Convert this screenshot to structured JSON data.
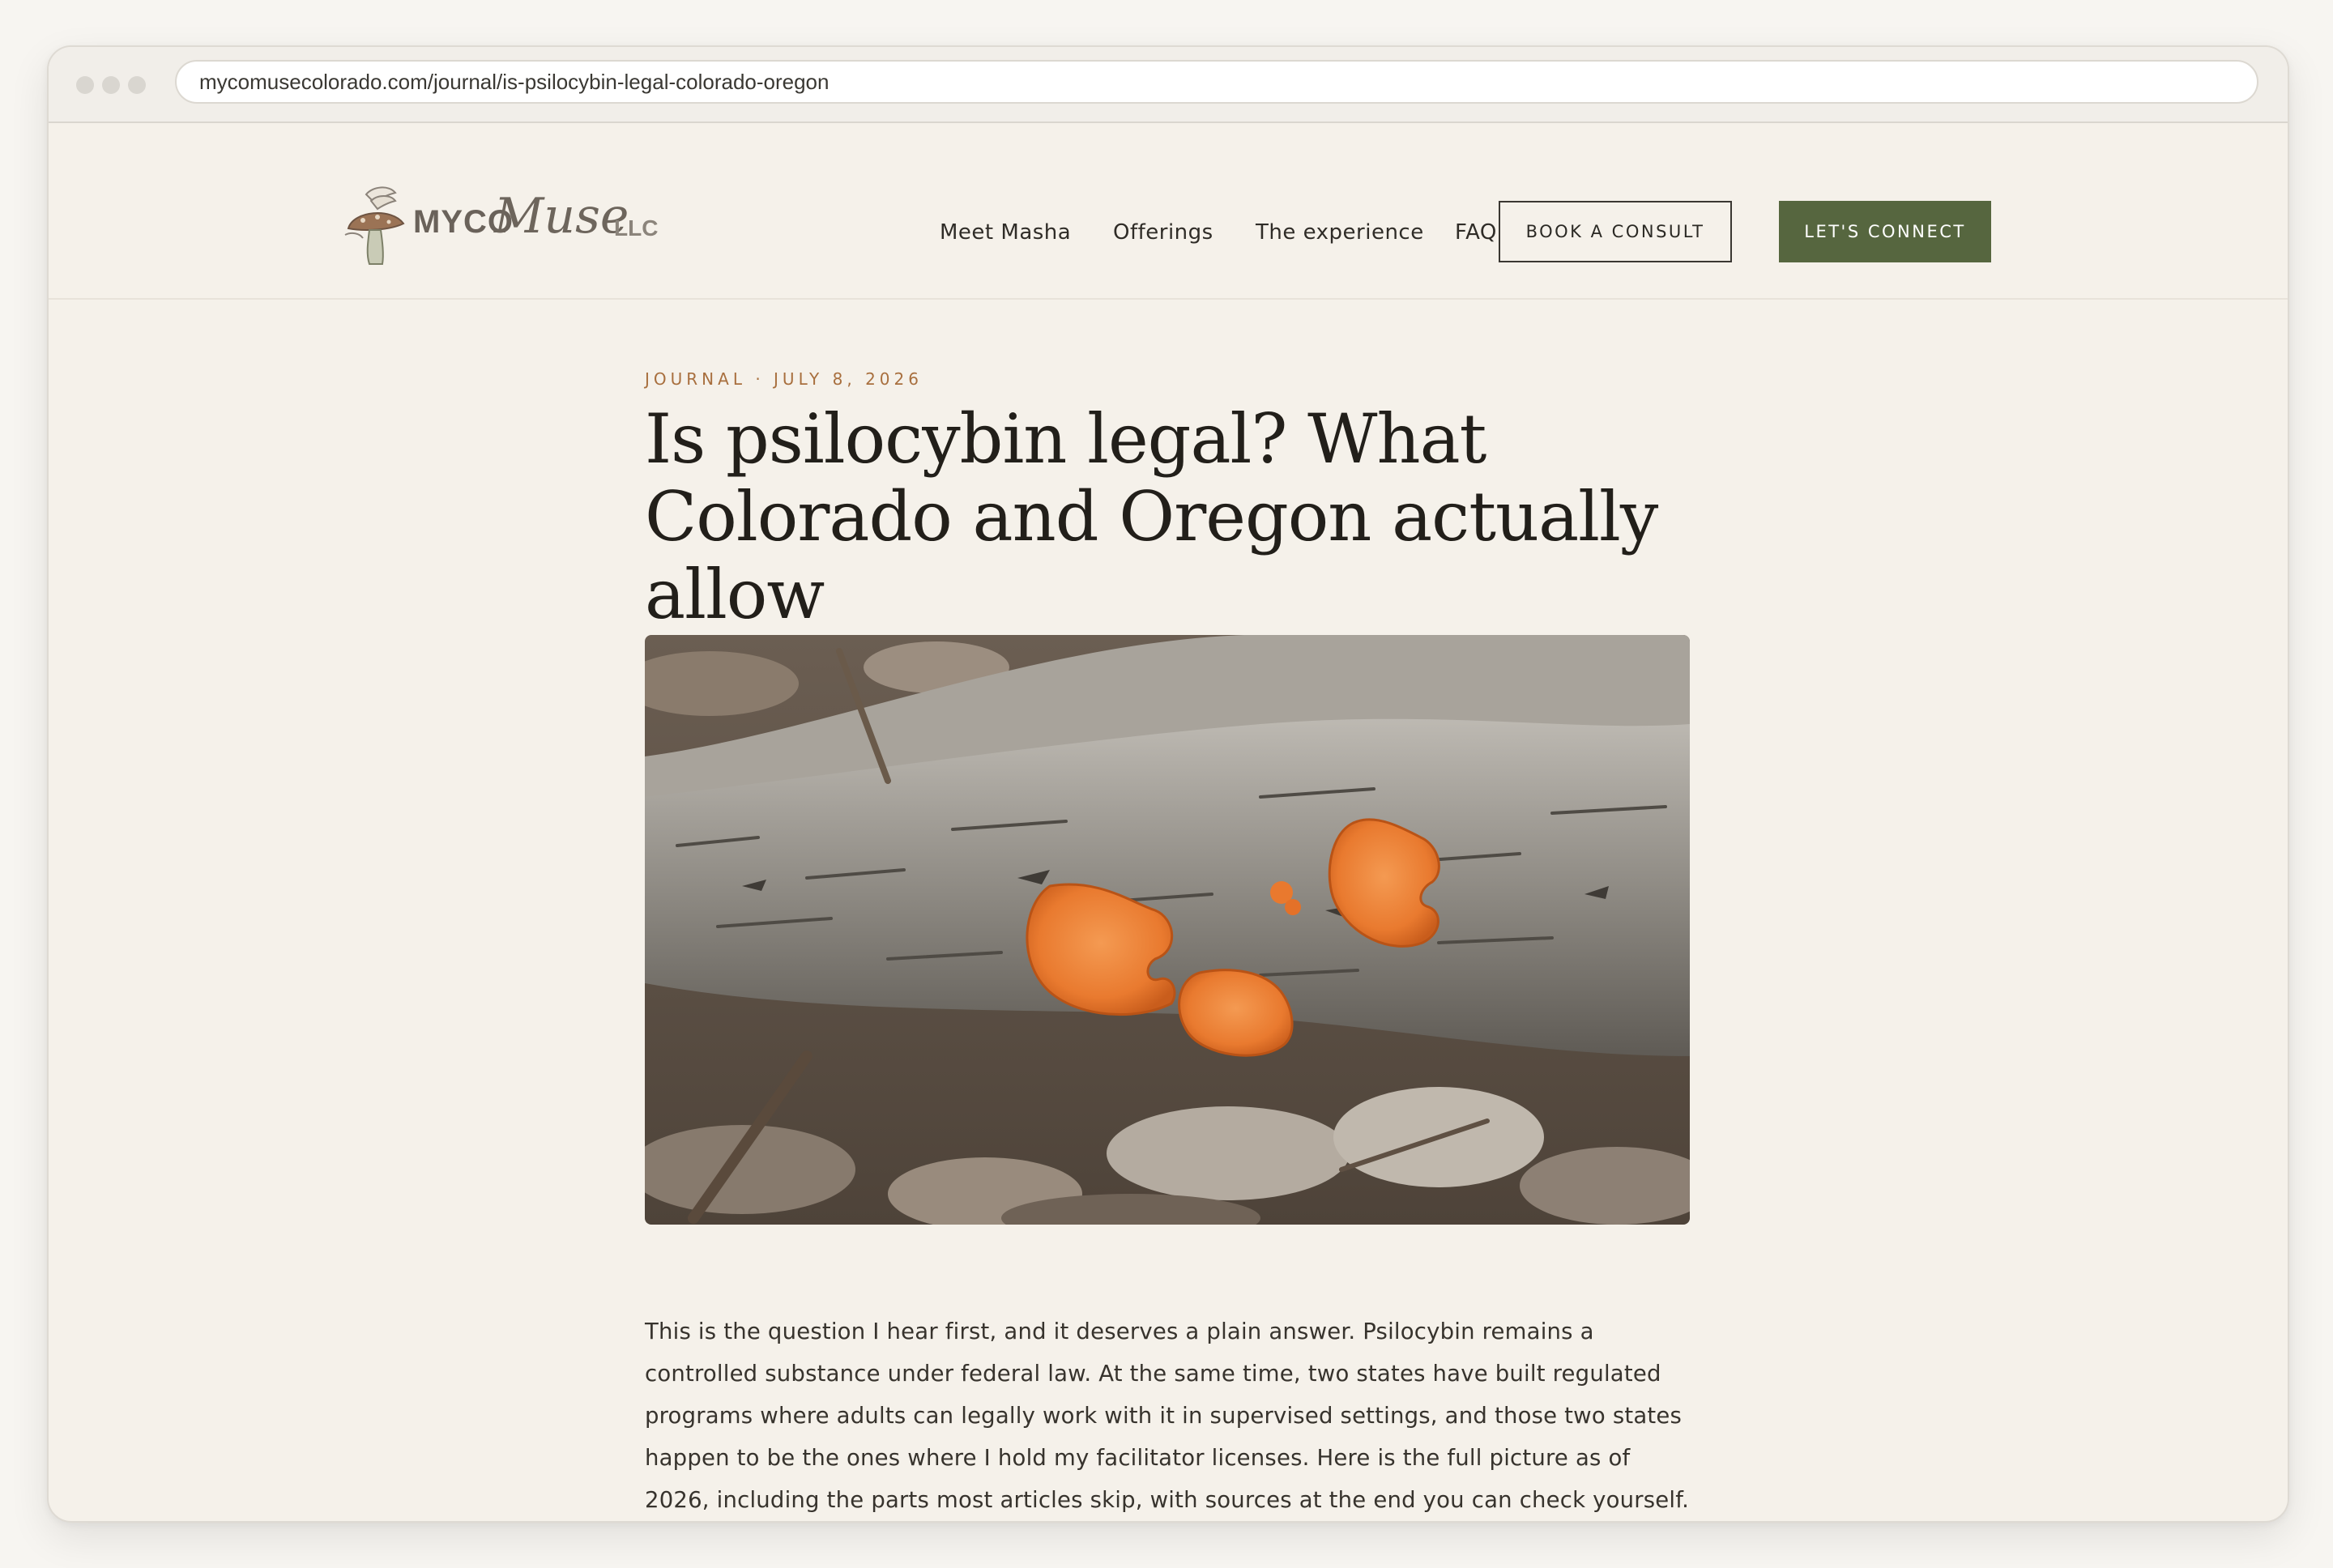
{
  "browser": {
    "url": "mycomusecolorado.com/journal/is-psilocybin-legal-colorado-oregon"
  },
  "brand": {
    "logo_text_main": "MYCO",
    "logo_text_script": "Muse",
    "logo_text_suffix": "LLC",
    "logo_icon": "mushroom-icon"
  },
  "nav": {
    "links": [
      {
        "label": "Meet Masha"
      },
      {
        "label": "Offerings"
      },
      {
        "label": "The experience"
      },
      {
        "label": "FAQ"
      }
    ],
    "book_button": "BOOK A CONSULT",
    "connect_button": "LET'S CONNECT"
  },
  "article": {
    "kicker": "JOURNAL · JULY 8, 2026",
    "title": "Is psilocybin legal? What Colorado and Oregon actually allow",
    "intro": "This is the question I hear first, and it deserves a plain answer. Psilocybin remains a controlled substance under federal law. At the same time, two states have built regulated programs where adults can legally work with it in supervised settings, and those two states happen to be the ones where I hold my facilitator licenses. Here is the full picture as of 2026, including the parts most articles skip, with sources at the end you can check yourself."
  },
  "colors": {
    "page_bg": "#f5f1ea",
    "accent_green": "#56663f",
    "kicker_orange": "#a86f3e",
    "text_dark": "#221f1a"
  }
}
